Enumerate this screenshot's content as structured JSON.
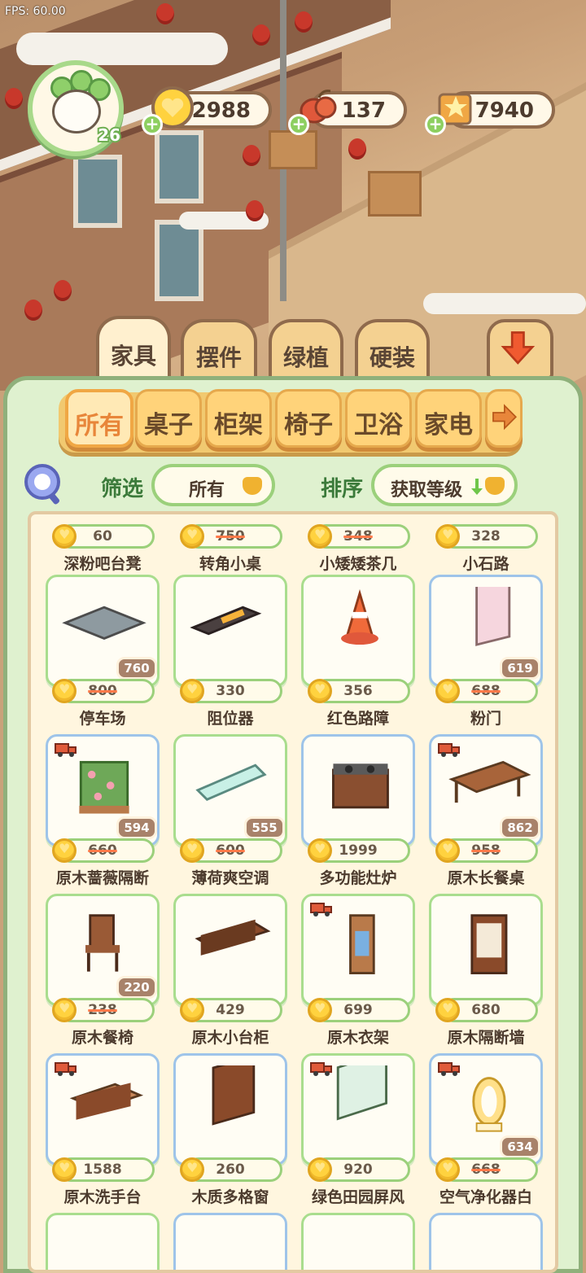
{
  "fps_label": "FPS: 60.00",
  "player": {
    "level": "26"
  },
  "resources": [
    {
      "name": "coin",
      "value": "2988",
      "icon": "gold-coin-icon"
    },
    {
      "name": "fruit",
      "value": "137",
      "icon": "red-fruit-icon"
    },
    {
      "name": "star",
      "value": "7940",
      "icon": "star-book-icon"
    }
  ],
  "main_tabs": [
    {
      "label": "家具",
      "active": true
    },
    {
      "label": "摆件",
      "active": false
    },
    {
      "label": "绿植",
      "active": false
    },
    {
      "label": "硬装",
      "active": false
    }
  ],
  "categories": [
    {
      "label": "所有",
      "active": true
    },
    {
      "label": "桌子",
      "active": false
    },
    {
      "label": "柜架",
      "active": false
    },
    {
      "label": "椅子",
      "active": false
    },
    {
      "label": "卫浴",
      "active": false
    },
    {
      "label": "家电",
      "active": false
    }
  ],
  "filter": {
    "label": "筛选",
    "value": "所有"
  },
  "sort": {
    "label": "排序",
    "value": "获取等级"
  },
  "top_row": [
    {
      "price": "60",
      "strike": false,
      "name": "深粉吧台凳"
    },
    {
      "price": "750",
      "strike": true,
      "name": "转角小桌"
    },
    {
      "price": "348",
      "strike": true,
      "name": "小矮矮茶几"
    },
    {
      "price": "328",
      "strike": false,
      "name": "小石路"
    }
  ],
  "items": [
    {
      "name": "停车场",
      "price": "800",
      "strike": true,
      "discount": "760",
      "frame": "green",
      "truck": false,
      "art": "parking"
    },
    {
      "name": "阻位器",
      "price": "330",
      "strike": false,
      "discount": "",
      "frame": "green",
      "truck": false,
      "art": "stopper"
    },
    {
      "name": "红色路障",
      "price": "356",
      "strike": false,
      "discount": "",
      "frame": "green",
      "truck": false,
      "art": "cone"
    },
    {
      "name": "粉门",
      "price": "688",
      "strike": true,
      "discount": "619",
      "frame": "blue",
      "truck": false,
      "art": "door"
    },
    {
      "name": "原木蔷薇隔断",
      "price": "660",
      "strike": true,
      "discount": "594",
      "frame": "blue",
      "truck": true,
      "art": "rose"
    },
    {
      "name": "薄荷爽空调",
      "price": "600",
      "strike": true,
      "discount": "555",
      "frame": "green",
      "truck": false,
      "art": "ac"
    },
    {
      "name": "多功能灶炉",
      "price": "1999",
      "strike": false,
      "discount": "",
      "frame": "blue",
      "truck": false,
      "art": "stove"
    },
    {
      "name": "原木长餐桌",
      "price": "958",
      "strike": true,
      "discount": "862",
      "frame": "blue",
      "truck": true,
      "art": "table"
    },
    {
      "name": "原木餐椅",
      "price": "238",
      "strike": true,
      "discount": "220",
      "frame": "green",
      "truck": false,
      "art": "chair"
    },
    {
      "name": "原木小台柜",
      "price": "429",
      "strike": false,
      "discount": "",
      "frame": "green",
      "truck": false,
      "art": "cabinet"
    },
    {
      "name": "原木衣架",
      "price": "699",
      "strike": false,
      "discount": "",
      "frame": "green",
      "truck": true,
      "art": "rack"
    },
    {
      "name": "原木隔断墙",
      "price": "680",
      "strike": false,
      "discount": "",
      "frame": "green",
      "truck": false,
      "art": "partition"
    },
    {
      "name": "原木洗手台",
      "price": "1588",
      "strike": false,
      "discount": "",
      "frame": "blue",
      "truck": true,
      "art": "sink"
    },
    {
      "name": "木质多格窗",
      "price": "260",
      "strike": false,
      "discount": "",
      "frame": "blue",
      "truck": false,
      "art": "window"
    },
    {
      "name": "绿色田园屏风",
      "price": "920",
      "strike": false,
      "discount": "",
      "frame": "green",
      "truck": true,
      "art": "screen"
    },
    {
      "name": "空气净化器白",
      "price": "668",
      "strike": true,
      "discount": "634",
      "frame": "blue",
      "truck": true,
      "art": "purifier"
    }
  ],
  "colors": {
    "panel_bg": "#dff1cf",
    "accent_orange": "#e8863a",
    "green_text": "#3b7a3a",
    "coin": "#ffd23f"
  }
}
